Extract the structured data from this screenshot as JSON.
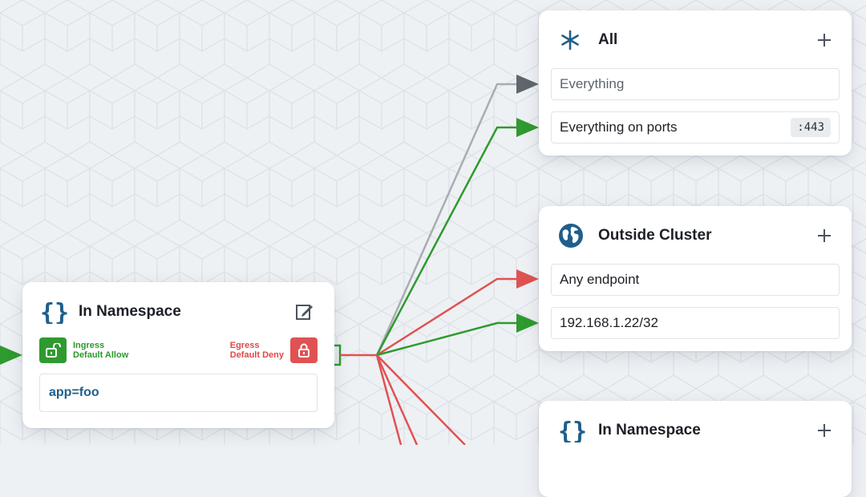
{
  "colors": {
    "allow": "#2f9a2f",
    "deny": "#e05252",
    "neutral_edge": "#a8adb3",
    "neutral_arrow": "#5f666e",
    "namespace_icon": "#1f5f8a",
    "selector_text": "#1f5f8a"
  },
  "source_node": {
    "title": "In Namespace",
    "icon": "braces-icon",
    "edit_icon": "edit-icon",
    "ingress": {
      "line1": "Ingress",
      "line2": "Default Allow",
      "icon": "unlocked-icon"
    },
    "egress": {
      "line1": "Egress",
      "line2": "Default Deny",
      "icon": "locked-icon"
    },
    "selector": "app=foo"
  },
  "target_nodes": [
    {
      "title": "All",
      "icon": "asterisk-icon",
      "add_icon": "plus-icon",
      "rows": [
        {
          "label": "Everything",
          "badge": ""
        },
        {
          "label": "Everything on ports",
          "badge": ":443"
        }
      ]
    },
    {
      "title": "Outside Cluster",
      "icon": "globe-icon",
      "add_icon": "plus-icon",
      "rows": [
        {
          "label": "Any endpoint",
          "badge": ""
        },
        {
          "label": "192.168.1.22/32",
          "badge": ""
        }
      ]
    },
    {
      "title": "In Namespace",
      "icon": "braces-icon",
      "add_icon": "plus-icon",
      "rows": []
    }
  ]
}
